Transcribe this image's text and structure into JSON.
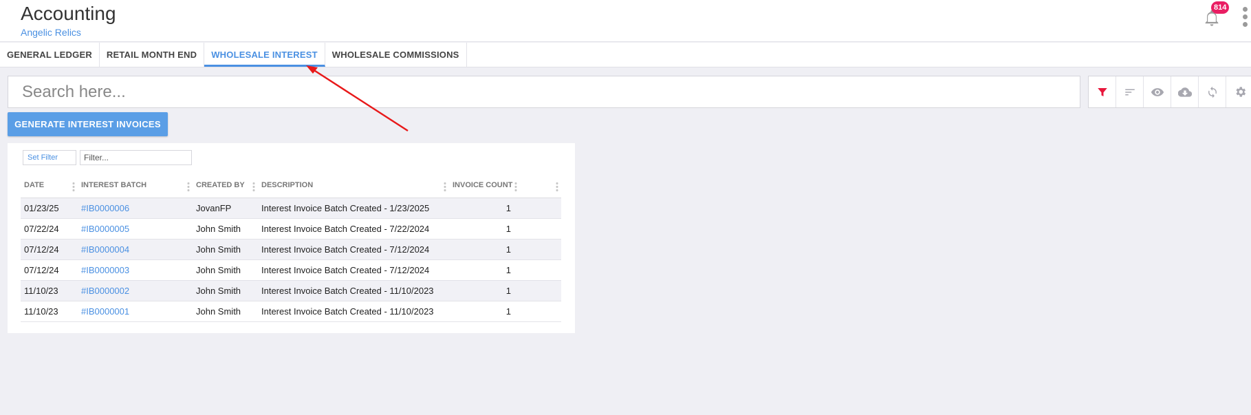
{
  "header": {
    "title": "Accounting",
    "subtitle": "Angelic Relics",
    "notification_count": "814"
  },
  "tabs": [
    {
      "label": "GENERAL LEDGER",
      "active": false
    },
    {
      "label": "RETAIL MONTH END",
      "active": false
    },
    {
      "label": "WHOLESALE INTEREST",
      "active": true
    },
    {
      "label": "WHOLESALE COMMISSIONS",
      "active": false
    }
  ],
  "search": {
    "placeholder": "Search here..."
  },
  "toolbar": {
    "icons": [
      "filter-icon",
      "sort-icon",
      "eye-icon",
      "cloud-download-icon",
      "refresh-icon",
      "gear-icon"
    ],
    "active_color": "#e8173c",
    "icon_color": "#a8a8b0"
  },
  "actions": {
    "generate_label": "GENERATE INTEREST INVOICES"
  },
  "filter": {
    "set_filter_label": "Set Filter",
    "placeholder": "Filter..."
  },
  "table": {
    "columns": [
      "DATE",
      "INTEREST BATCH",
      "CREATED BY",
      "DESCRIPTION",
      "INVOICE COUNT"
    ],
    "rows": [
      {
        "date": "01/23/25",
        "batch": "#IB0000006",
        "created_by": "JovanFP",
        "description": "Interest Invoice Batch Created - 1/23/2025",
        "count": "1"
      },
      {
        "date": "07/22/24",
        "batch": "#IB0000005",
        "created_by": "John Smith",
        "description": "Interest Invoice Batch Created - 7/22/2024",
        "count": "1"
      },
      {
        "date": "07/12/24",
        "batch": "#IB0000004",
        "created_by": "John Smith",
        "description": "Interest Invoice Batch Created - 7/12/2024",
        "count": "1"
      },
      {
        "date": "07/12/24",
        "batch": "#IB0000003",
        "created_by": "John Smith",
        "description": "Interest Invoice Batch Created - 7/12/2024",
        "count": "1"
      },
      {
        "date": "11/10/23",
        "batch": "#IB0000002",
        "created_by": "John Smith",
        "description": "Interest Invoice Batch Created - 11/10/2023",
        "count": "1"
      },
      {
        "date": "11/10/23",
        "batch": "#IB0000001",
        "created_by": "John Smith",
        "description": "Interest Invoice Batch Created - 11/10/2023",
        "count": "1"
      }
    ]
  },
  "colors": {
    "accent": "#4a90e2",
    "annotation_arrow": "#e8191a",
    "badge": "#e91e63"
  }
}
